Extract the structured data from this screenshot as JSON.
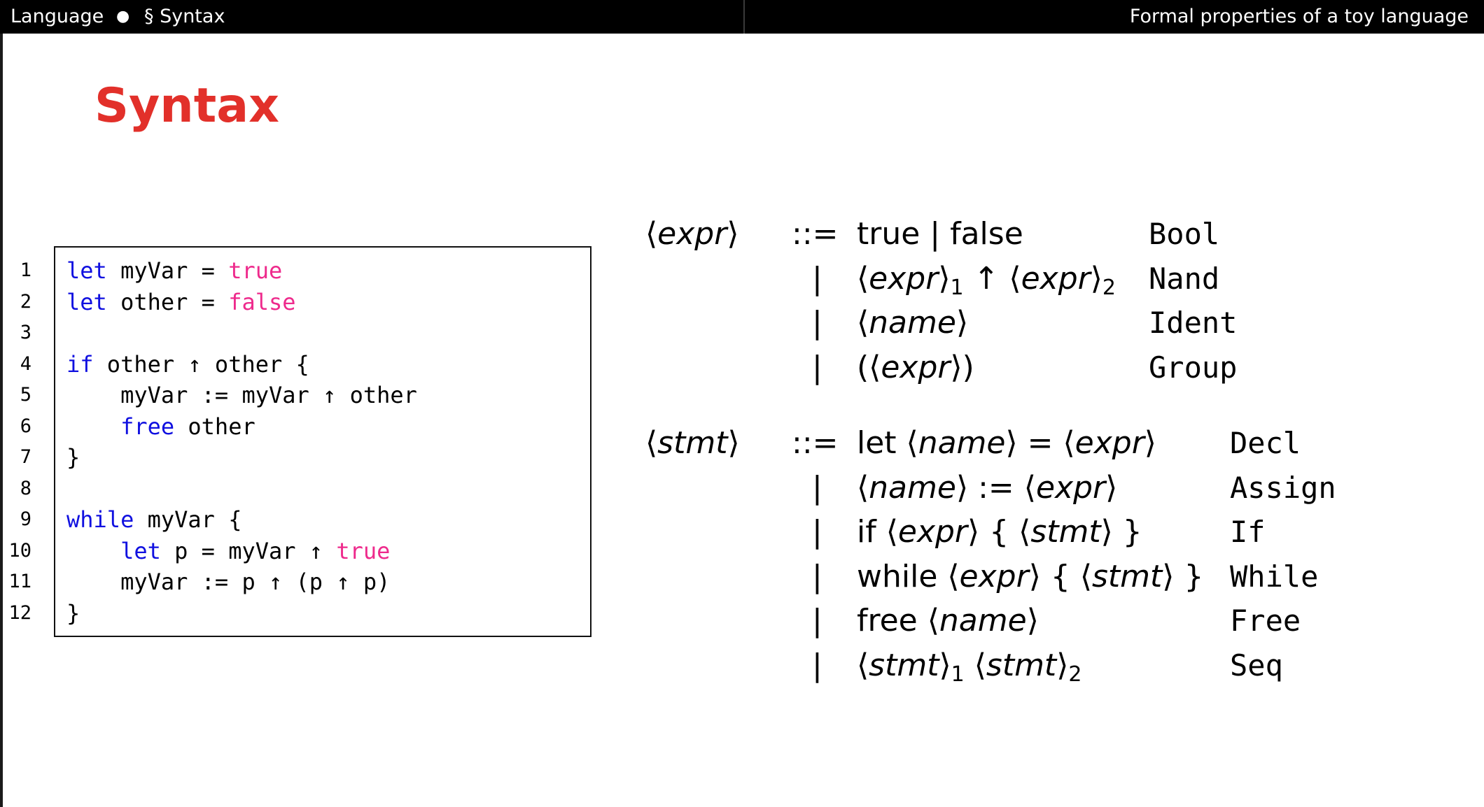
{
  "header": {
    "section": "Language",
    "bullet": "●",
    "subsection": "§ Syntax",
    "presentation_title": "Formal properties of a toy language"
  },
  "slide": {
    "title": "Syntax"
  },
  "code": {
    "line_numbers": [
      "1",
      "2",
      "3",
      "4",
      "5",
      "6",
      "7",
      "8",
      "9",
      "10",
      "11",
      "12"
    ],
    "lines": [
      [
        {
          "t": "let",
          "c": "kw"
        },
        {
          "t": " myVar = ",
          "c": ""
        },
        {
          "t": "true",
          "c": "lit"
        }
      ],
      [
        {
          "t": "let",
          "c": "kw"
        },
        {
          "t": " other = ",
          "c": ""
        },
        {
          "t": "false",
          "c": "lit"
        }
      ],
      [],
      [
        {
          "t": "if",
          "c": "kw"
        },
        {
          "t": " other ↑ other {",
          "c": ""
        }
      ],
      [
        {
          "t": "    myVar := myVar ↑ other",
          "c": ""
        }
      ],
      [
        {
          "t": "    ",
          "c": ""
        },
        {
          "t": "free",
          "c": "kw"
        },
        {
          "t": " other",
          "c": ""
        }
      ],
      [
        {
          "t": "}",
          "c": ""
        }
      ],
      [],
      [
        {
          "t": "while",
          "c": "kw"
        },
        {
          "t": " myVar {",
          "c": ""
        }
      ],
      [
        {
          "t": "    ",
          "c": ""
        },
        {
          "t": "let",
          "c": "kw"
        },
        {
          "t": " p = myVar ↑ ",
          "c": ""
        },
        {
          "t": "true",
          "c": "lit"
        }
      ],
      [
        {
          "t": "    myVar := p ↑ (p ↑ p)",
          "c": ""
        }
      ],
      [
        {
          "t": "}",
          "c": ""
        }
      ]
    ]
  },
  "grammar": {
    "expr": {
      "nonterminal": "⟨expr⟩",
      "defines": "::=",
      "bar": "|",
      "rules": [
        {
          "production": "true | false",
          "label": "Bool"
        },
        {
          "production": "⟨expr⟩₁ ↑ ⟨expr⟩₂",
          "label": "Nand"
        },
        {
          "production": "⟨name⟩",
          "label": "Ident"
        },
        {
          "production": "(⟨expr⟩)",
          "label": "Group"
        }
      ]
    },
    "stmt": {
      "nonterminal": "⟨stmt⟩",
      "defines": "::=",
      "bar": "|",
      "rules": [
        {
          "production": "let ⟨name⟩ = ⟨expr⟩",
          "label": "Decl"
        },
        {
          "production": "⟨name⟩ := ⟨expr⟩",
          "label": "Assign"
        },
        {
          "production": "if ⟨expr⟩ { ⟨stmt⟩ }",
          "label": "If"
        },
        {
          "production": "while ⟨expr⟩ { ⟨stmt⟩ }",
          "label": "While"
        },
        {
          "production": "free ⟨name⟩",
          "label": "Free"
        },
        {
          "production": "⟨stmt⟩₁ ⟨stmt⟩₂",
          "label": "Seq"
        }
      ]
    }
  }
}
